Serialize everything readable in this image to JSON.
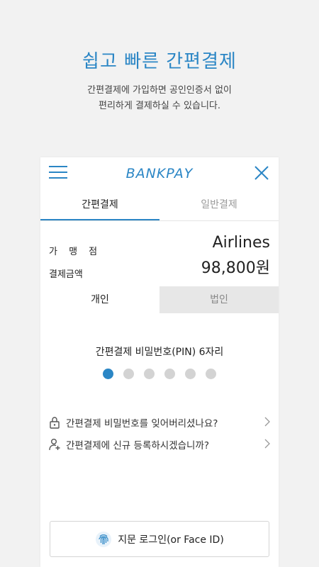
{
  "hero": {
    "title": "쉽고 빠른 간편결제",
    "subtitle_line1": "간편결제에 가입하면 공인인증서 없이",
    "subtitle_line2": "편리하게 결제하실 수 있습니다."
  },
  "header": {
    "logo_text": "BANKPAY",
    "menu_icon": "hamburger-icon",
    "close_icon": "close-icon"
  },
  "tabs": [
    {
      "label": "간편결제",
      "active": true
    },
    {
      "label": "일반결제",
      "active": false
    }
  ],
  "payment": {
    "merchant_label": "가 맹 점",
    "merchant_value": "Airlines",
    "amount_label": "결제금액",
    "amount_value": "98,800원"
  },
  "subtabs": [
    {
      "label": "개인",
      "active": true
    },
    {
      "label": "법인",
      "active": false
    }
  ],
  "pin": {
    "title": "간편결제 비밀번호(PIN) 6자리",
    "entered": 1,
    "total": 6
  },
  "links": [
    {
      "label": "간편결제 비밀번호를 잊어버리셨나요?",
      "icon": "lock-icon"
    },
    {
      "label": "간편결제에 신규 등록하시겠습니까?",
      "icon": "add-user-icon"
    }
  ],
  "fingerprint_button": {
    "label": "지문 로그인(or Face ID)",
    "icon": "fingerprint-icon"
  },
  "colors": {
    "accent": "#2b86c5",
    "dot_inactive": "#d3d3d3",
    "background": "#f2f2f2"
  }
}
